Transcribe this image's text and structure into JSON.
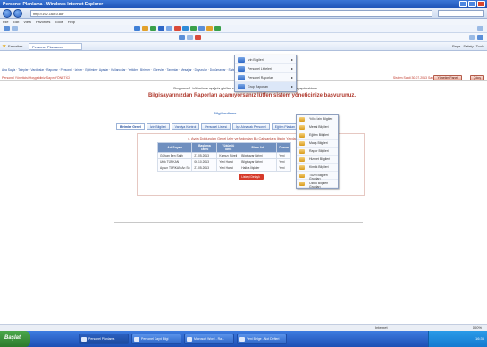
{
  "window": {
    "title": "Personel Planlama - Windows Internet Explorer",
    "address_url": "http://192.168.0.88/",
    "menu": [
      "File",
      "Edit",
      "View",
      "Favorites",
      "Tools",
      "Help"
    ],
    "favorites_label": "Favorites",
    "tab_label": "Personel Planlama",
    "command_bar": [
      "Page",
      "Safety",
      "Tools"
    ]
  },
  "site": {
    "nav_links": "Ana Sayfa · Talepler · Vardiyalar · Raporlar · Personel · İzinler · Eğitimler · Ayarlar · Kullanıcılar · Yetkiler · Birimler · Görevler · Tanımlar · Mesajlar · Duyurular · Dokümanlar · Sistem · Yardım · Çıkış",
    "user_left": "Personel Yöneticisi   Hoşgeldiniz Sayın YÖNETİCİ",
    "user_right": "Sistem Saati 30.07.2013 Salı",
    "user_button_1": "Yönetim Paneli",
    "user_button_2": "Çıkış"
  },
  "main": {
    "info_text": "Programın 1. bölümünde aşağıda görülen raporlar veya talepler doğrultusunda çalışmalar yapılmaktadır.",
    "headline": "Bilgisayarınızdan Raporları açamıyorsanız lütfen sistem yöneticinize başvurunuz.",
    "section_banner": "Bilgilendirme",
    "tabs": [
      "Birimler Genel",
      "İzin Bilgileri",
      "Vardiya Kontrol",
      "Personel Listesi",
      "İşe Alınacak Personel",
      "Eğitim Planları"
    ]
  },
  "report": {
    "title": "4. Ayda Doldurulan Genel İzler ve Ardından Bu Çalışanlara İlişkin Yapılacak İşlemler",
    "columns": [
      "Adı Soyadı",
      "Başlama Tarihi",
      "Yükümlü Tarih",
      "Birim Adı",
      "Durum"
    ],
    "rows": [
      [
        "Gürkan Ben Salih",
        "27.05.2013",
        "Kırmızı Süreli",
        "Bilgisayar Birimi",
        "Yeni"
      ],
      [
        "Ufuk TÜRKAN",
        "06.10.2013",
        "Yeni Harici",
        "Bilgisayar Birimi",
        "Yeni"
      ],
      [
        "Aysun TÜRKAN Arı Su",
        "27.05.2013",
        "Yeni Harici",
        "Halkla İlişkiler",
        "Yeni"
      ]
    ],
    "detail_button": "Listeyi Detaylı Görüntüle"
  },
  "context_menu": {
    "items": [
      {
        "label": "İzin Bilgileri",
        "has_arrow": true
      },
      {
        "label": "Personel Listeleri",
        "has_arrow": true
      },
      {
        "label": "Personel Raporları",
        "has_arrow": true
      },
      {
        "label": "Grup Raporları",
        "has_arrow": true,
        "highlight": true
      }
    ],
    "submenu": [
      "Yıllık İzin Bilgileri",
      "Mesai Bilgileri",
      "Eğitim Bilgileri",
      "Maaş Bilgileri",
      "Rapor Bilgileri",
      "Hizmet Bilgileri",
      "Kimlik Bilgileri",
      "Tüzel Bilgileri Grupları",
      "Özlük Bilgileri Grupları"
    ]
  },
  "statusbar": {
    "zone": "Internet",
    "zoom": "100%"
  },
  "taskbar": {
    "start": "Başlat",
    "buttons": [
      "Personel Planlama",
      "Personel Kayıt Bilgi",
      "Microsoft Word - Ra...",
      "Yeni Belge - Not Defteri"
    ],
    "clock": "16:36"
  },
  "colors": {
    "accent": "#244e9c",
    "headline_red": "#b03a2e",
    "table_header": "#6f8fbf",
    "taskbar_blue": "#2a5fc8"
  }
}
